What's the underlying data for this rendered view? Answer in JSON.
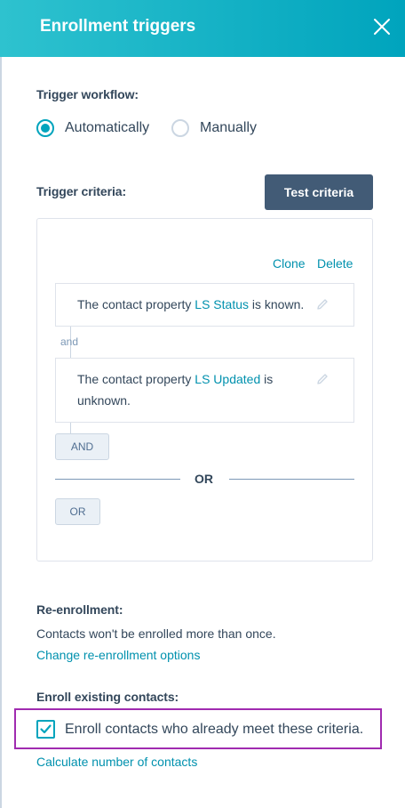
{
  "header": {
    "title": "Enrollment triggers",
    "close_icon": "close-icon"
  },
  "trigger_workflow": {
    "label": "Trigger workflow:",
    "options": [
      {
        "label": "Automatically",
        "selected": true
      },
      {
        "label": "Manually",
        "selected": false
      }
    ]
  },
  "trigger_criteria": {
    "label": "Trigger criteria:",
    "test_button": "Test criteria",
    "clone_link": "Clone",
    "delete_link": "Delete",
    "filters": [
      {
        "prefix": "The contact property ",
        "property": "LS Status",
        "suffix": " is known."
      },
      {
        "prefix": "The contact property ",
        "property": "LS Updated",
        "suffix": " is",
        "suffix_line2": "unknown."
      }
    ],
    "and_connector": "and",
    "and_button": "AND",
    "or_divider": "OR",
    "or_button": "OR"
  },
  "re_enrollment": {
    "label": "Re-enrollment:",
    "description": "Contacts won't be enrolled more than once.",
    "change_link": "Change re-enrollment options"
  },
  "enroll_existing": {
    "label": "Enroll existing contacts:",
    "checkbox_label": "Enroll contacts who already meet these criteria.",
    "checked": true,
    "calculate_link": "Calculate number of contacts"
  },
  "colors": {
    "header": "#00a4bd",
    "accent": "#00a4bd",
    "link": "#0091ae",
    "primary_button": "#425b76",
    "highlight_border": "#a02bb0"
  }
}
